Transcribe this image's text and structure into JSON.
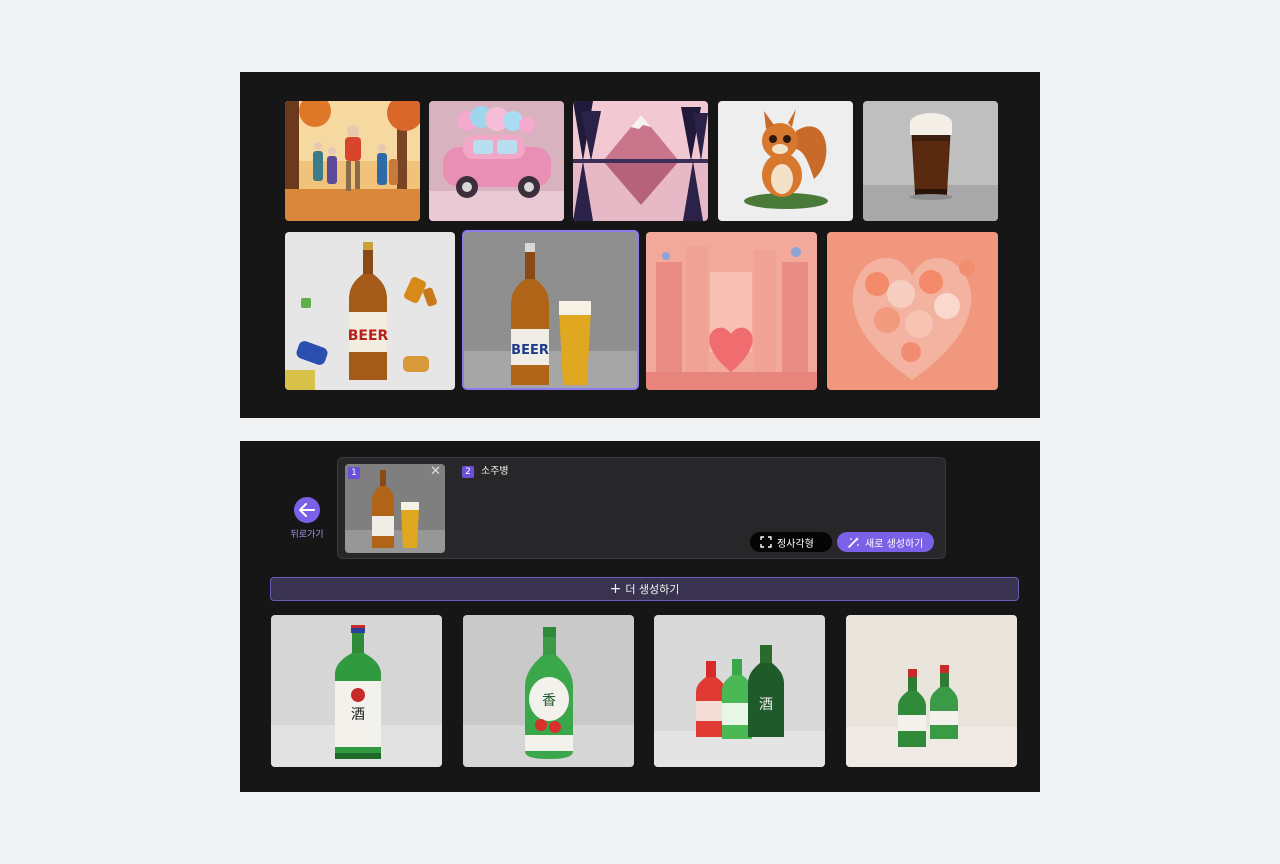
{
  "back_label": "뒤로가기",
  "prompt": {
    "thumb_number": "1",
    "close_glyph": "✕",
    "prompt_number": "2",
    "prompt_text": "소주병"
  },
  "buttons": {
    "square_label": "정사각형",
    "regenerate_label": "새로 생성하기",
    "more_plus": "+",
    "more_label": "더 생성하기"
  },
  "top_gallery": [
    {
      "name": "autumn-dance-image",
      "icon": "dancing-elders-autumn"
    },
    {
      "name": "cotton-candy-car-image",
      "icon": "pink-car"
    },
    {
      "name": "mountain-lake-image",
      "icon": "mountain-reflection"
    },
    {
      "name": "squirrel-image",
      "icon": "cartoon-squirrel"
    },
    {
      "name": "dark-beer-glass-image",
      "icon": "beer-glass"
    },
    {
      "name": "beer-bottle-cans-image",
      "icon": "beer-bottle"
    },
    {
      "name": "beer-bottle-glass-image",
      "icon": "beer-bottle-and-glass",
      "selected": true
    },
    {
      "name": "heart-castle-image",
      "icon": "heart-city"
    },
    {
      "name": "flower-heart-image",
      "icon": "flower-heart"
    }
  ],
  "results": [
    {
      "name": "soju-result-1",
      "icon": "single-soju-bottle"
    },
    {
      "name": "soju-result-2",
      "icon": "green-soju-bottle"
    },
    {
      "name": "soju-result-3",
      "icon": "three-soju-bottles"
    },
    {
      "name": "soju-result-4",
      "icon": "two-soju-bottles"
    }
  ],
  "colors": {
    "accent": "#7b61e8",
    "panel_bg": "#161616",
    "page_bg": "#f1f2f4"
  }
}
